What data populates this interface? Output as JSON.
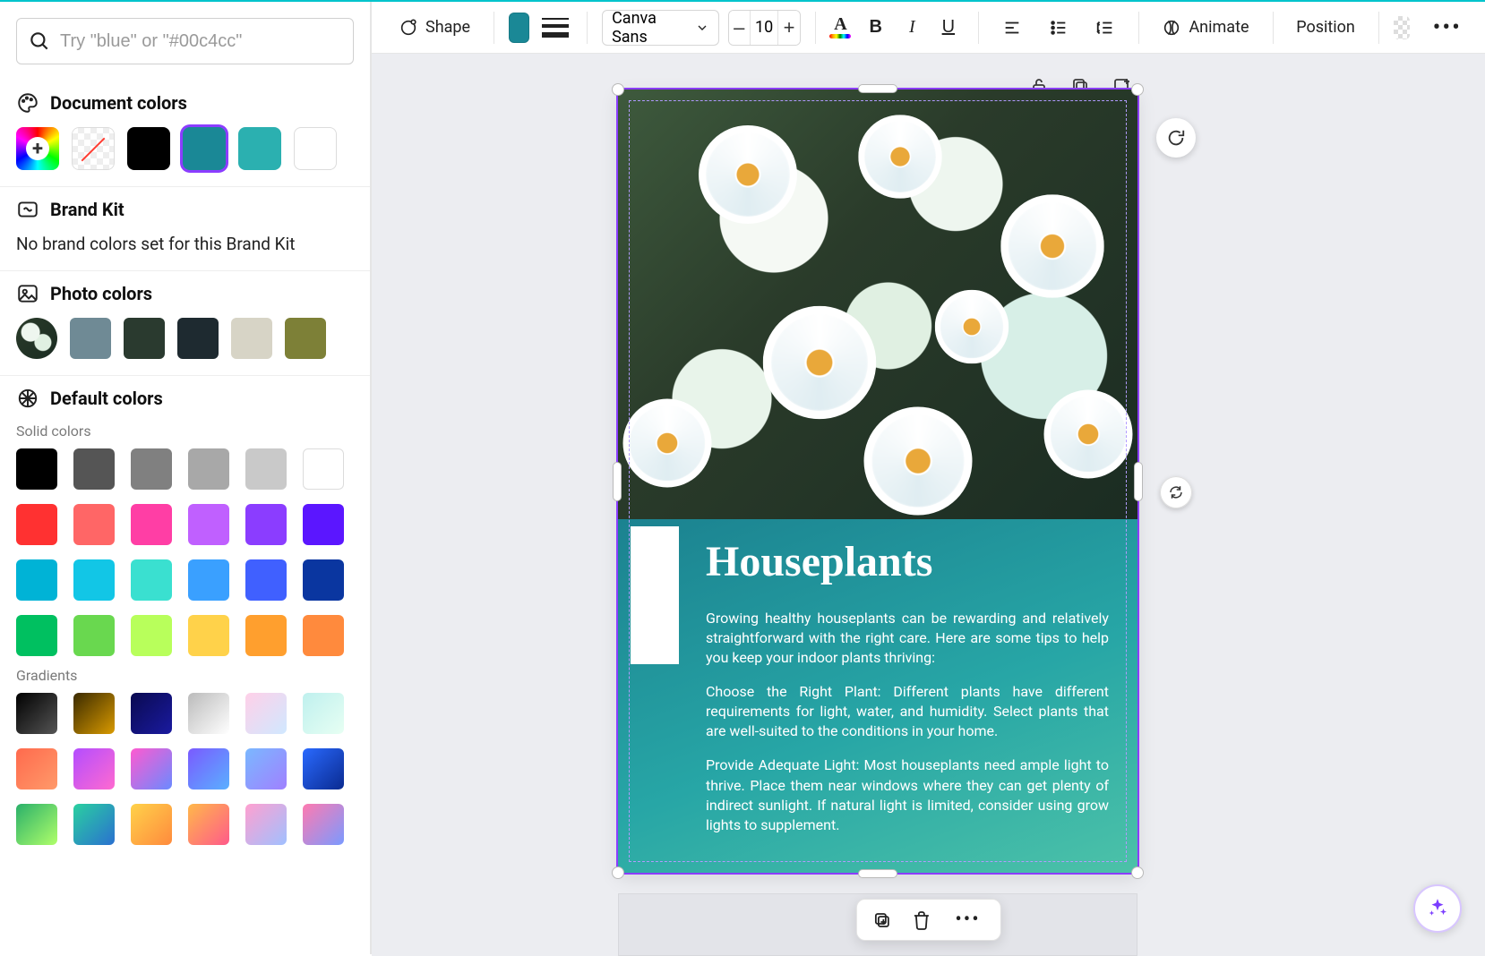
{
  "search": {
    "placeholder": "Try \"blue\" or \"#00c4cc\""
  },
  "sections": {
    "document_colors": "Document colors",
    "brand_kit": "Brand Kit",
    "brand_kit_msg": "No brand colors set for this Brand Kit",
    "photo_colors": "Photo colors",
    "default_colors": "Default colors",
    "solid_label": "Solid colors",
    "gradients_label": "Gradients"
  },
  "doc_colors": {
    "selected_index": 3,
    "items": [
      {
        "type": "add"
      },
      {
        "type": "transparent"
      },
      {
        "color": "#000000"
      },
      {
        "color": "#1a8896"
      },
      {
        "color": "#2bb0b0"
      },
      {
        "color": "#ffffff",
        "border": true
      }
    ]
  },
  "photo_colors": [
    {
      "type": "thumb"
    },
    {
      "color": "#6f8a95"
    },
    {
      "color": "#2a3a2f"
    },
    {
      "color": "#1e2a30"
    },
    {
      "color": "#d7d4c6"
    },
    {
      "color": "#7d8037"
    }
  ],
  "solid_colors": [
    "#000000",
    "#555555",
    "#808080",
    "#a8a8a8",
    "#c9c9c9",
    "#ffffff",
    "#ff3131",
    "#ff6666",
    "#ff3ea5",
    "#c060ff",
    "#8b3dff",
    "#5b16ff",
    "#00b3d6",
    "#12c6e6",
    "#3ae0d0",
    "#3aa0ff",
    "#4060ff",
    "#0a36a0",
    "#00c060",
    "#69d84f",
    "#b8ff5b",
    "#ffd24a",
    "#ff9f2e",
    "#ff8a3d"
  ],
  "gradient_presets": [
    "linear-gradient(135deg,#000,#555)",
    "linear-gradient(135deg,#3a2a00,#d99a00)",
    "linear-gradient(135deg,#0a0a50,#1a1aa0)",
    "linear-gradient(135deg,#bbb,#fff)",
    "linear-gradient(135deg,#ffd0e8,#d0e8ff)",
    "linear-gradient(135deg,#bff0ee,#e7fff3)",
    "linear-gradient(135deg,#ff6a4d,#ff9a6a)",
    "linear-gradient(135deg,#b34dff,#ff6ad0)",
    "linear-gradient(135deg,#ff5ad0,#6a8aff)",
    "linear-gradient(135deg,#7a5aff,#5ab0ff)",
    "linear-gradient(135deg,#7ab8ff,#a080ff)",
    "linear-gradient(135deg,#2a6aff,#0a2a90)",
    "linear-gradient(135deg,#2ab06a,#b0ff6a)",
    "linear-gradient(135deg,#2ad0a0,#2a70d0)",
    "linear-gradient(135deg,#ffd24a,#ff8a3d)",
    "linear-gradient(135deg,#ffb84a,#ff5a8a)",
    "linear-gradient(135deg,#ffa0d0,#a0c0ff)",
    "linear-gradient(135deg,#ff7ab0,#7a9aff)"
  ],
  "toolbar": {
    "shape": "Shape",
    "font_name": "Canva Sans",
    "font_size": "10",
    "animate": "Animate",
    "position": "Position"
  },
  "document": {
    "title": "Houseplants",
    "p1": "Growing healthy houseplants can be rewarding and relatively straightforward with the right care. Here are some tips to help you keep your indoor plants thriving:",
    "p2": "Choose the Right Plant: Different plants have different requirements for light, water, and humidity. Select plants that are well-suited to the conditions in your home.",
    "p3": "Provide Adequate Light: Most houseplants need ample light to thrive. Place them near windows where they can get plenty of indirect sunlight. If natural light is limited, consider using grow lights to supplement."
  }
}
